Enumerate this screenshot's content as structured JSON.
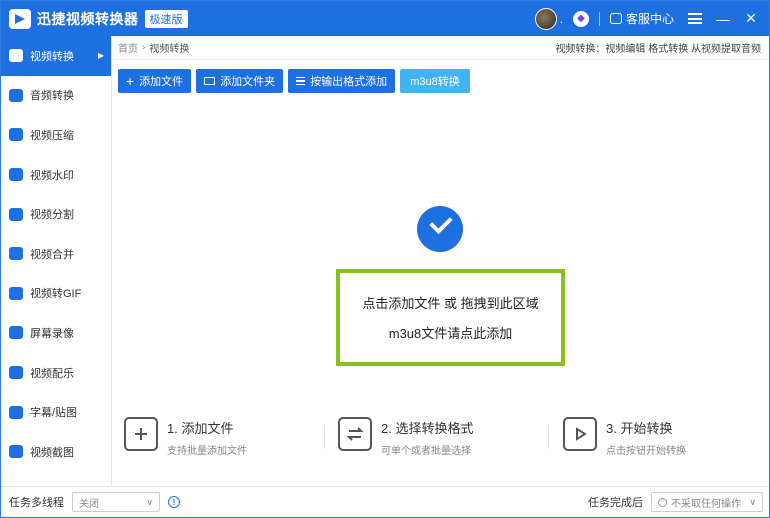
{
  "app": {
    "title": "迅捷视频转换器",
    "edition": "极速版",
    "dot": ".",
    "customer_service": "客服中心",
    "colors": {
      "primary": "#1e6fe0",
      "light_button": "#42b4f0",
      "drop_border": "#86c21c"
    }
  },
  "sidebar": {
    "items": [
      {
        "label": "视频转换",
        "icon": "video-convert-icon",
        "active": true
      },
      {
        "label": "音频转换",
        "icon": "audio-convert-icon"
      },
      {
        "label": "视频压缩",
        "icon": "video-compress-icon"
      },
      {
        "label": "视频水印",
        "icon": "video-watermark-icon"
      },
      {
        "label": "视频分割",
        "icon": "video-split-icon"
      },
      {
        "label": "视频合并",
        "icon": "video-merge-icon"
      },
      {
        "label": "视频转GIF",
        "icon": "video-gif-icon"
      },
      {
        "label": "屏幕录像",
        "icon": "screen-record-icon"
      },
      {
        "label": "视频配乐",
        "icon": "video-music-icon"
      },
      {
        "label": "字幕/贴图",
        "icon": "subtitle-sticker-icon"
      },
      {
        "label": "视频截图",
        "icon": "video-screenshot-icon"
      }
    ]
  },
  "breadcrumb": {
    "home": "首页",
    "separator": "›",
    "current": "视频转换",
    "right_text": "视频转换：视频编辑 格式转换 从视频提取音频"
  },
  "toolbar": {
    "add_file": "添加文件",
    "add_folder": "添加文件夹",
    "add_by_format": "按输出格式添加",
    "m3u8": "m3u8转换"
  },
  "dropzone": {
    "line1": "点击添加文件 或 拖拽到此区域",
    "line2": "m3u8文件请点此添加"
  },
  "steps": [
    {
      "title": "1. 添加文件",
      "desc": "支持批量添加文件"
    },
    {
      "title": "2. 选择转换格式",
      "desc": "可单个或者批量选择"
    },
    {
      "title": "3. 开始转换",
      "desc": "点击按钮开始转换"
    }
  ],
  "statusbar": {
    "multithread_label": "任务多线程",
    "multithread_value": "关闭",
    "after_done_label": "任务完成后",
    "after_done_value": "不采取任何操作"
  }
}
